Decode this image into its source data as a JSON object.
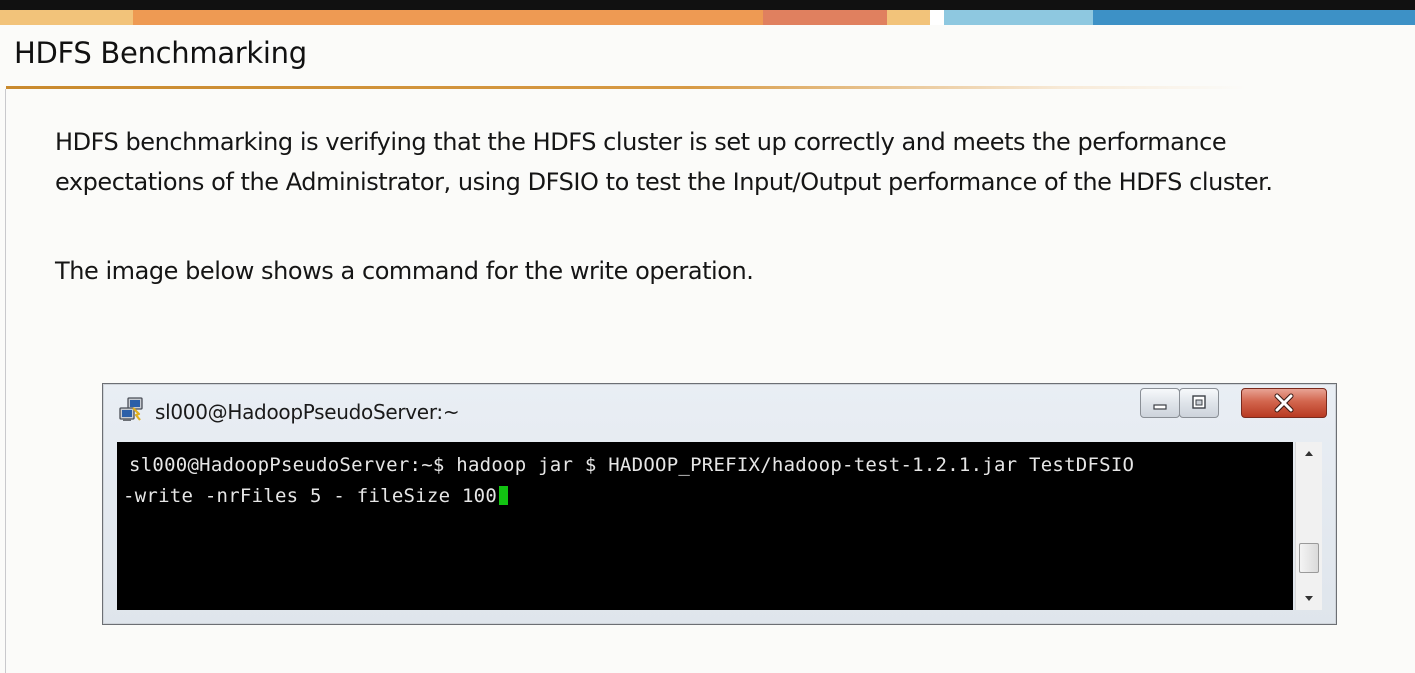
{
  "slide": {
    "title": "HDFS Benchmarking",
    "paragraph_1_line_1": "HDFS benchmarking is verifying that the HDFS cluster is set up correctly and meets the performance",
    "paragraph_1_line_2": "expectations of the Administrator, using DFSIO to test the Input/Output performance of the HDFS cluster.",
    "paragraph_2": "The image below shows a command for the write operation."
  },
  "colors": {
    "band": [
      "#f2c37a",
      "#ee9a53",
      "#e0805f",
      "#f2c37a",
      "#8ec8e0",
      "#3d91c6"
    ]
  },
  "terminal": {
    "window_title": "sl000@HadoopPseudoServer:~",
    "line_1": "sl000@HadoopPseudoServer:~$ hadoop jar $ HADOOP_PREFIX/hadoop-test-1.2.1.jar TestDFSIO",
    "line_2": "-write -nrFiles 5 - fileSize 100",
    "icons": {
      "app": "putty-icon",
      "minimize": "minimize-icon",
      "maximize": "maximize-icon",
      "close": "close-icon",
      "scroll_up": "scroll-up-arrow-icon",
      "scroll_down": "scroll-down-arrow-icon"
    }
  }
}
